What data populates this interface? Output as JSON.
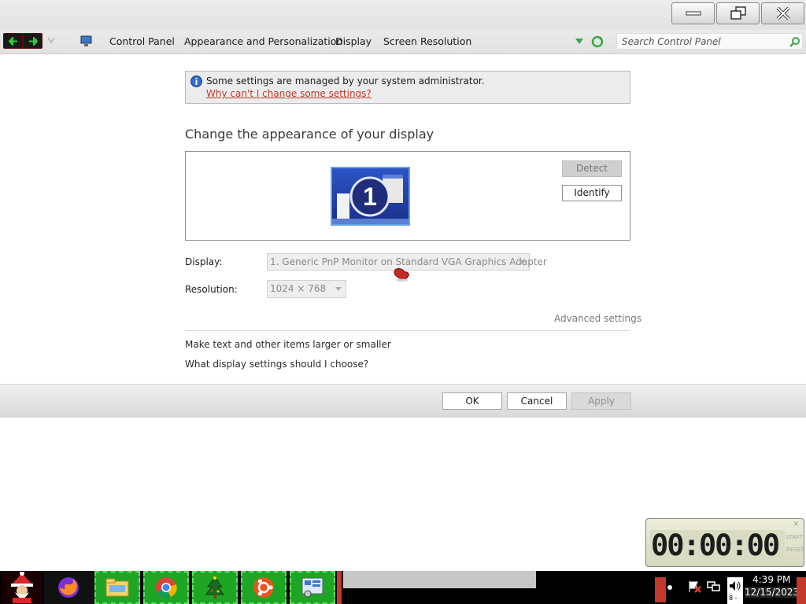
{
  "window": {
    "buttons": {
      "minimize": "minimize-icon",
      "maximize": "restore-icon",
      "close": "close-icon"
    }
  },
  "address_bar": {
    "breadcrumbs": [
      "Control Panel",
      "Appearance and Personalization",
      "Display",
      "Screen Resolution"
    ],
    "search_placeholder": "Search Control Panel"
  },
  "info_bar": {
    "message": "Some settings are managed by your system administrator.",
    "link": "Why can't I change some settings?"
  },
  "page": {
    "heading": "Change the appearance of your display",
    "monitor_number": "1",
    "detect_label": "Detect",
    "identify_label": "Identify",
    "display_label": "Display:",
    "display_value": "1. Generic PnP Monitor on Standard VGA Graphics Adapter",
    "resolution_label": "Resolution:",
    "resolution_value": "1024 × 768",
    "advanced_link": "Advanced settings",
    "link_text_size": "Make text and other items larger or smaller",
    "link_help": "What display settings should I choose?"
  },
  "dialog_buttons": {
    "ok": "OK",
    "cancel": "Cancel",
    "apply": "Apply"
  },
  "clock_widget": {
    "time": "00:00:00",
    "start": "START",
    "reset": "RESET",
    "close": "×"
  },
  "taskbar": {
    "apps": [
      "start-santa",
      "firefox",
      "file-explorer",
      "chrome",
      "christmas-tree",
      "ubuntu",
      "control-panel"
    ],
    "tray_volume_level": "8 -",
    "time": "4:39 PM",
    "date": "12/15/2023"
  },
  "colors": {
    "link_red": "#c0392b",
    "taskbar_green": "#1ea524",
    "accent_blue": "#2b55c4"
  }
}
